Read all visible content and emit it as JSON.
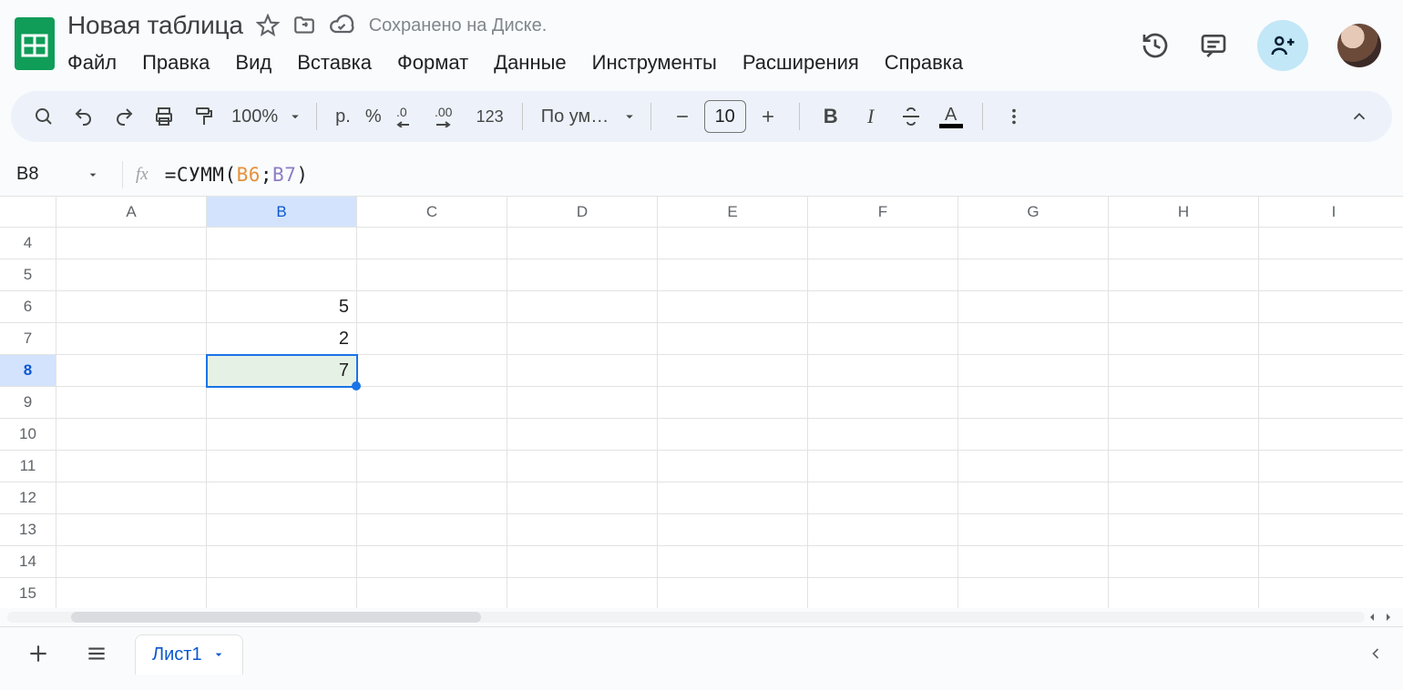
{
  "doc_title": "Новая таблица",
  "save_status": "Сохранено на Диске.",
  "menu": [
    "Файл",
    "Правка",
    "Вид",
    "Вставка",
    "Формат",
    "Данные",
    "Инструменты",
    "Расширения",
    "Справка"
  ],
  "toolbar": {
    "zoom": "100%",
    "currency_label": "р.",
    "percent_label": "%",
    "num_label": "123",
    "font_label": "По ум…",
    "font_size": "10"
  },
  "namebox": "B8",
  "formula": {
    "fn": "=СУММ",
    "open": "(",
    "arg1": "B6",
    "sep": ";",
    "arg2": "B7",
    "close": ")"
  },
  "columns": [
    "A",
    "B",
    "C",
    "D",
    "E",
    "F",
    "G",
    "H",
    "I"
  ],
  "rows": [
    4,
    5,
    6,
    7,
    8,
    9,
    10,
    11,
    12,
    13,
    14,
    15
  ],
  "active_col": "B",
  "active_row": 8,
  "cells": {
    "B6": "5",
    "B7": "2",
    "B8": "7"
  },
  "sheet_name": "Лист1"
}
